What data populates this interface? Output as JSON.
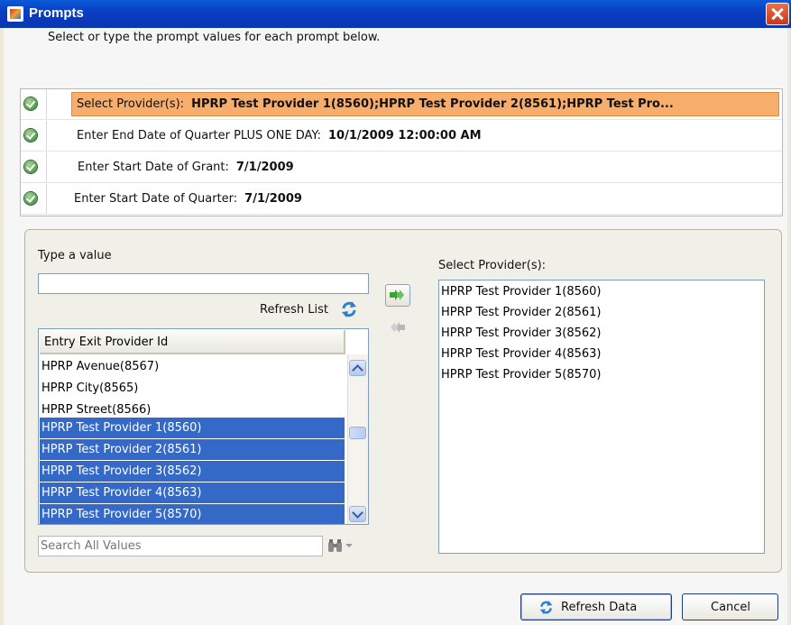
{
  "window": {
    "title": "Prompts"
  },
  "instructions": "Select or type the prompt values for each prompt below.",
  "prompts": [
    {
      "label": "Select Provider(s):",
      "value": "HPRP Test Provider 1(8560);HPRP Test Provider 2(8561);HPRP Test Pro...",
      "selected": true
    },
    {
      "label": "Enter End Date of Quarter PLUS ONE DAY:",
      "value": "10/1/2009 12:00:00 AM"
    },
    {
      "label": "Enter Start Date of Grant:",
      "value": "7/1/2009"
    },
    {
      "label": "Enter Start Date of Quarter:",
      "value": "7/1/2009"
    }
  ],
  "type_value_label": "Type a value",
  "refresh_list_label": "Refresh List",
  "source_list": {
    "header": "Entry Exit Provider Id",
    "items": [
      {
        "label": "HPRP Avenue(8567)",
        "selected": false
      },
      {
        "label": "HPRP City(8565)",
        "selected": false
      },
      {
        "label": "HPRP Street(8566)",
        "selected": false
      },
      {
        "label": "HPRP Test Provider 1(8560)",
        "selected": true
      },
      {
        "label": "HPRP Test Provider 2(8561)",
        "selected": true
      },
      {
        "label": "HPRP Test Provider 3(8562)",
        "selected": true
      },
      {
        "label": "HPRP Test Provider 4(8563)",
        "selected": true
      },
      {
        "label": "HPRP Test Provider 5(8570)",
        "selected": true
      }
    ]
  },
  "search_placeholder": "Search All Values",
  "target_label": "Select Provider(s):",
  "target_items": [
    "HPRP Test Provider 1(8560)",
    "HPRP Test Provider 2(8561)",
    "HPRP Test Provider 3(8562)",
    "HPRP Test Provider 4(8563)",
    "HPRP Test Provider 5(8570)"
  ],
  "buttons": {
    "refresh": "Refresh Data",
    "cancel": "Cancel"
  },
  "icons": {
    "title": "java-app-icon",
    "close": "close-icon",
    "check": "check-icon",
    "refresh": "refresh-icon",
    "add": "add-arrow-icon",
    "remove": "remove-arrow-icon",
    "binoculars": "binoculars-icon"
  },
  "colors": {
    "titlebar": "#0a4ad0",
    "selected_prompt": "#f7ad6b",
    "selected_item": "#3569c7"
  }
}
